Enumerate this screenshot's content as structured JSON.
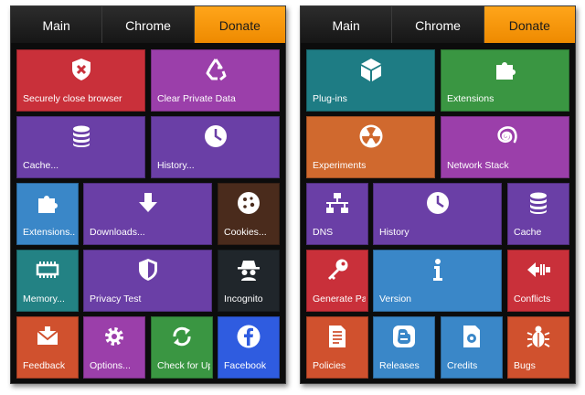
{
  "left_panel": {
    "tabs": [
      "Main",
      "Chrome",
      "Donate"
    ],
    "tiles": [
      {
        "label": "Securely close browser",
        "icon": "shield-x-icon",
        "color": "#c9303a"
      },
      {
        "label": "Clear Private Data",
        "icon": "recycle-icon",
        "color": "#9b3faa"
      },
      {
        "label": "Cache...",
        "icon": "database-icon",
        "color": "#6a3fa6"
      },
      {
        "label": "History...",
        "icon": "clock-icon",
        "color": "#6a3fa6"
      },
      {
        "label": "Extensions...",
        "icon": "puzzle-icon",
        "color": "#3a87c8"
      },
      {
        "label": "Downloads...",
        "icon": "download-arrow-icon",
        "color": "#6a3fa6"
      },
      {
        "label": "Cookies...",
        "icon": "cookie-icon",
        "color": "#4a2b1c"
      },
      {
        "label": "Memory...",
        "icon": "memory-chip-icon",
        "color": "#238284"
      },
      {
        "label": "Privacy Test",
        "icon": "shield-icon",
        "color": "#6a3fa6"
      },
      {
        "label": "Incognito",
        "icon": "spy-icon",
        "color": "#20262b"
      },
      {
        "label": "Feedback",
        "icon": "envelope-icon",
        "color": "#d0512e"
      },
      {
        "label": "Options...",
        "icon": "gear-icon",
        "color": "#9b3faa"
      },
      {
        "label": "Check for Updates",
        "icon": "refresh-icon",
        "color": "#3a9642"
      },
      {
        "label": "Facebook",
        "icon": "facebook-icon",
        "color": "#2f5ce0"
      }
    ]
  },
  "right_panel": {
    "tabs": [
      "Main",
      "Chrome",
      "Donate"
    ],
    "tiles": [
      {
        "label": "Plug-ins",
        "icon": "cube-icon",
        "color": "#1e7c84"
      },
      {
        "label": "Extensions",
        "icon": "puzzle-icon",
        "color": "#3a9642"
      },
      {
        "label": "Experiments",
        "icon": "radiation-icon",
        "color": "#d0692e"
      },
      {
        "label": "Network Stack",
        "icon": "spiral-icon",
        "color": "#9b3faa"
      },
      {
        "label": "DNS",
        "icon": "network-icon",
        "color": "#6a3fa6"
      },
      {
        "label": "History",
        "icon": "clock-icon",
        "color": "#6a3fa6"
      },
      {
        "label": "Cache",
        "icon": "database-icon",
        "color": "#6a3fa6"
      },
      {
        "label": "Generate Password",
        "icon": "key-icon",
        "color": "#c9303a"
      },
      {
        "label": "Version",
        "icon": "info-icon",
        "color": "#3a87c8"
      },
      {
        "label": "Conflicts",
        "icon": "conflict-arrows-icon",
        "color": "#c9303a"
      },
      {
        "label": "Policies",
        "icon": "document-icon",
        "color": "#d0512e"
      },
      {
        "label": "Releases",
        "icon": "blogger-icon",
        "color": "#3a87c8"
      },
      {
        "label": "Credits",
        "icon": "chrome-doc-icon",
        "color": "#3a87c8"
      },
      {
        "label": "Bugs",
        "icon": "bug-icon",
        "color": "#d0512e"
      }
    ]
  }
}
